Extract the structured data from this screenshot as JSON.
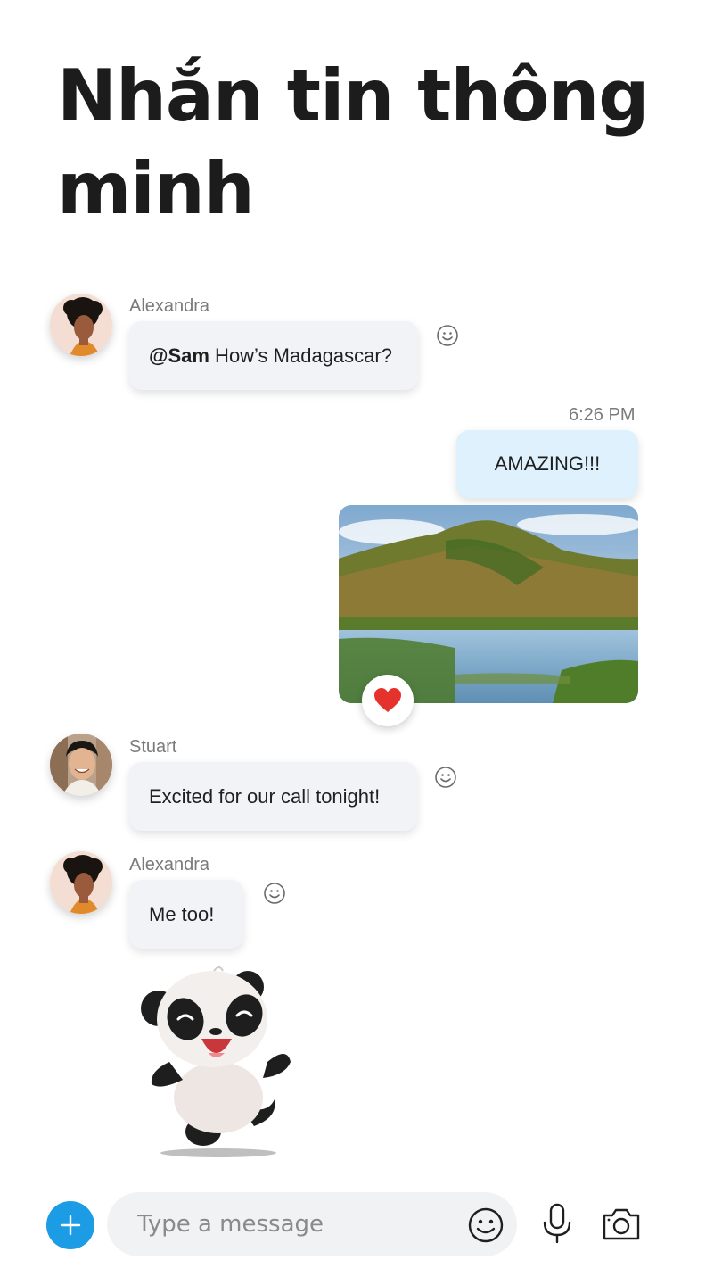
{
  "headline": "Nhắn tin thông minh",
  "messages": {
    "m1": {
      "sender": "Alexandra",
      "mention": "@Sam",
      "text": " How’s Madagascar?"
    },
    "mine": {
      "time": "6:26 PM",
      "text": "AMAZING!!!"
    },
    "m2": {
      "sender": "Stuart",
      "text": "Excited for our call tonight!"
    },
    "m3": {
      "sender": "Alexandra",
      "text": "Me too!"
    }
  },
  "composer": {
    "placeholder": "Type a message"
  },
  "colors": {
    "accent": "#1d9ce6",
    "my_bubble": "#dff1fd",
    "their_bubble": "#f1f3f7",
    "heart": "#e5322d"
  },
  "icons": [
    "add-icon",
    "emoji-icon",
    "microphone-icon",
    "camera-icon",
    "heart-icon",
    "smiley-reaction-icon"
  ]
}
